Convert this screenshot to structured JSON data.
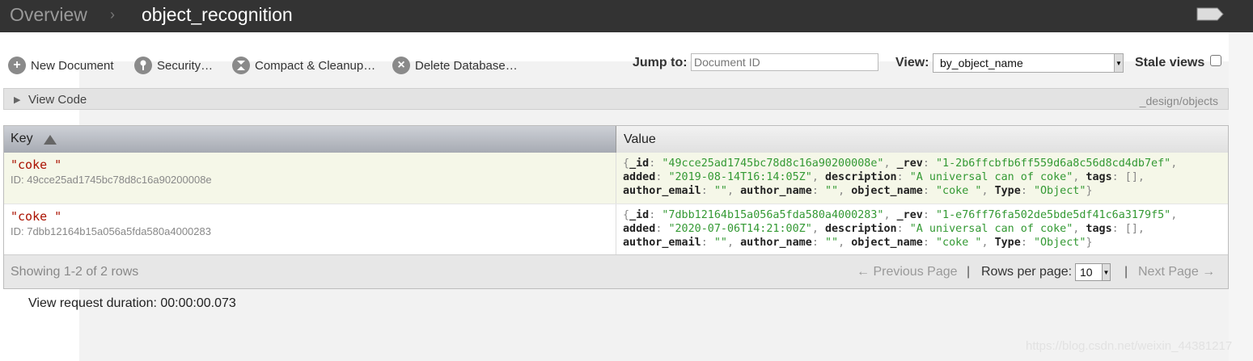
{
  "topbar": {
    "breadcrumb_root": "Overview",
    "breadcrumb_sep": "›",
    "database_name": "object_recognition"
  },
  "toolbar": {
    "new_document": "New Document",
    "security": "Security…",
    "compact": "Compact & Cleanup…",
    "delete_db": "Delete Database…",
    "jump_label": "Jump to:",
    "jump_placeholder": "Document ID",
    "view_label": "View:",
    "view_selected": "by_object_name",
    "stale_label": "Stale views"
  },
  "view_code": {
    "label": "View Code",
    "design_path": "_design/objects"
  },
  "table": {
    "col_key": "Key",
    "col_value": "Value",
    "rows": [
      {
        "key": "\"coke \"",
        "id_line": "ID: 49cce25ad1745bc78d8c16a90200008e",
        "v": {
          "id": "\"49cce25ad1745bc78d8c16a90200008e\"",
          "rev": "\"1-2b6ffcbfb6ff559d6a8c56d8cd4db7ef\"",
          "added": "\"2019-08-14T16:14:05Z\"",
          "description": "\"A universal can of coke\"",
          "tags": "[]",
          "author_email": "\"\"",
          "author_name": "\"\"",
          "object_name": "\"coke \"",
          "type": "\"Object\""
        }
      },
      {
        "key": "\"coke \"",
        "id_line": "ID: 7dbb12164b15a056a5fda580a4000283",
        "v": {
          "id": "\"7dbb12164b15a056a5fda580a4000283\"",
          "rev": "\"1-e76ff76fa502de5bde5df41c6a3179f5\"",
          "added": "\"2020-07-06T14:21:00Z\"",
          "description": "\"A universal can of coke\"",
          "tags": "[]",
          "author_email": "\"\"",
          "author_name": "\"\"",
          "object_name": "\"coke \"",
          "type": "\"Object\""
        }
      }
    ],
    "field_names": {
      "id": "_id",
      "rev": "_rev",
      "added": "added",
      "description": "description",
      "tags": "tags",
      "author_email": "author_email",
      "author_name": "author_name",
      "object_name": "object_name",
      "type": "Type"
    }
  },
  "footer": {
    "showing": "Showing 1-2 of 2 rows",
    "prev": "← Previous Page",
    "sep": "|",
    "rows_per_page_label": "Rows per page:",
    "rows_per_page": "10",
    "next": "Next Page →"
  },
  "duration": {
    "text": "View request duration:  00:00:00.073"
  },
  "watermark": "https://blog.csdn.net/weixin_44381217",
  "colors": {
    "topbar": "#333333",
    "key_text": "#aa1100",
    "string_value": "#339933",
    "selected_row": "#f5f7e8"
  }
}
